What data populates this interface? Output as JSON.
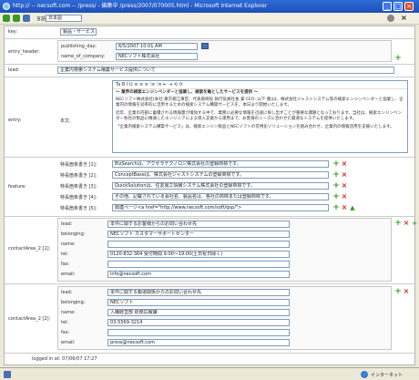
{
  "window": {
    "title": "http:// -- necsoft.com -- /press/ - 編集中 /press/2007/070005.html - Microsoft Internet Explorer",
    "min": "_",
    "max": "□",
    "close": "×"
  },
  "toolbar": {
    "lang_label": "言語",
    "lang_value": "日本語"
  },
  "form": {
    "key_label": "key:",
    "key_value": "製品・サービス",
    "entry_header_label": "entry_header:",
    "publishing_day_label": "publishing_day:",
    "publishing_day_value": "6/5/2007 10:01 AM",
    "name_of_company_label": "name_of_company:",
    "name_of_company_value": "NECソフト株式会社",
    "lead_label": "lead:",
    "lead_value": "企業内検索システム構築サービス提供について",
    "entry_label": "entry:",
    "honbun_label": "本文:",
    "rte_toolbar": "Ta  B  I  U   ≡ ≡ ≡   ⁝≡ ⁝≡   ⇤ ⇥   ⟲ ⟳",
    "rte_heading": "〜 業界の検索エンジンベンダーと協業し、検索を軸としたサービスを提供 〜",
    "rte_p1": "NECソフト株式会社(本社:東京都江東区、代表取締役 執行役員社長 兼 CEO: 山下 徹)は、株式会社ジャストシステム等の検索エンジンベンダーと協業し、企業内の情報を効率的に活用するための検索システム構築サービスを、本日より開始いたします。",
    "rte_p2": "近年、企業の内部に蓄積される情報量が増加する中で、業務に必要な情報を迅速に探し出すことが重要な課題となっております。当社は、検索エンジンベンダー各社の製品に精通したエンジニアによる導入支援から運用まで、お客様のニーズに合わせた最適なシステムを提供いたします。",
    "rte_p3": "「企業内検索システム構築サービス」は、検索エンジン製品とNECソフトの可視化ソリューションを組み合わせ、企業内の情報活用を支援いたします。",
    "feature_label": "feature:",
    "features": [
      {
        "label": "特長箇条書き [1]:",
        "value": "BizSearchは、アクセラテクノロジ株式会社の登録商標です。"
      },
      {
        "label": "特長箇条書き [2]:",
        "value": "ConceptBaseは、株式会社ジャストシステムの登録商標です。"
      },
      {
        "label": "特長箇条書き [3]:",
        "value": "QuickSolutionは、住友電工情報システム株式会社の登録商標です。"
      },
      {
        "label": "特長箇条書き [4]:",
        "value": "その他、記載されている会社名、製品名は、各社の商標または登録商標です。"
      },
      {
        "label": "特長箇条書き [5]:",
        "value": "関連ページ<a href=\"http://www.necsoft.com/soft/qsp/\">"
      }
    ],
    "contacts": [
      {
        "label": "contactArea_2 [1]:",
        "lead_label": "lead:",
        "lead": "本件に関するお客様からのお問い合わせ先",
        "belonging_label": "belonging:",
        "belonging": "NECソフト カスタマーサポートセンター",
        "name_label": "name:",
        "name": "",
        "tel_label": "tel:",
        "tel": "0120-832-364 受付時間 9:00〜19:00(土日祝日除く)",
        "fax_label": "fax:",
        "fax": "",
        "email_label": "email:",
        "email": "info@necsoft.com"
      },
      {
        "label": "contactArea_2 [2]:",
        "lead_label": "lead:",
        "lead": "本件に関する報道関係からのお問い合わせ先",
        "belonging_label": "belonging:",
        "belonging": "NECソフト",
        "name_label": "name:",
        "name": "入職経営部 総務広報課",
        "tel_label": "tel:",
        "tel": "03-5569-3214",
        "fax_label": "fax:",
        "fax": "",
        "email_label": "email:",
        "email": "press@necsoft.com"
      }
    ],
    "logged_in": "logged in at: 07/06/07 17:27"
  },
  "statusbar": {
    "zone": "インターネット"
  },
  "colors": {
    "title_blue": "#1e4fb8",
    "plus_green": "#3a9a23",
    "cross_red": "#d32b1e"
  },
  "icons": [
    "ie-icon",
    "back-icon",
    "forward-icon",
    "save-icon",
    "calendar-icon",
    "plus-icon",
    "cross-icon",
    "up-arrow-icon",
    "globe-icon",
    "search-icon"
  ]
}
